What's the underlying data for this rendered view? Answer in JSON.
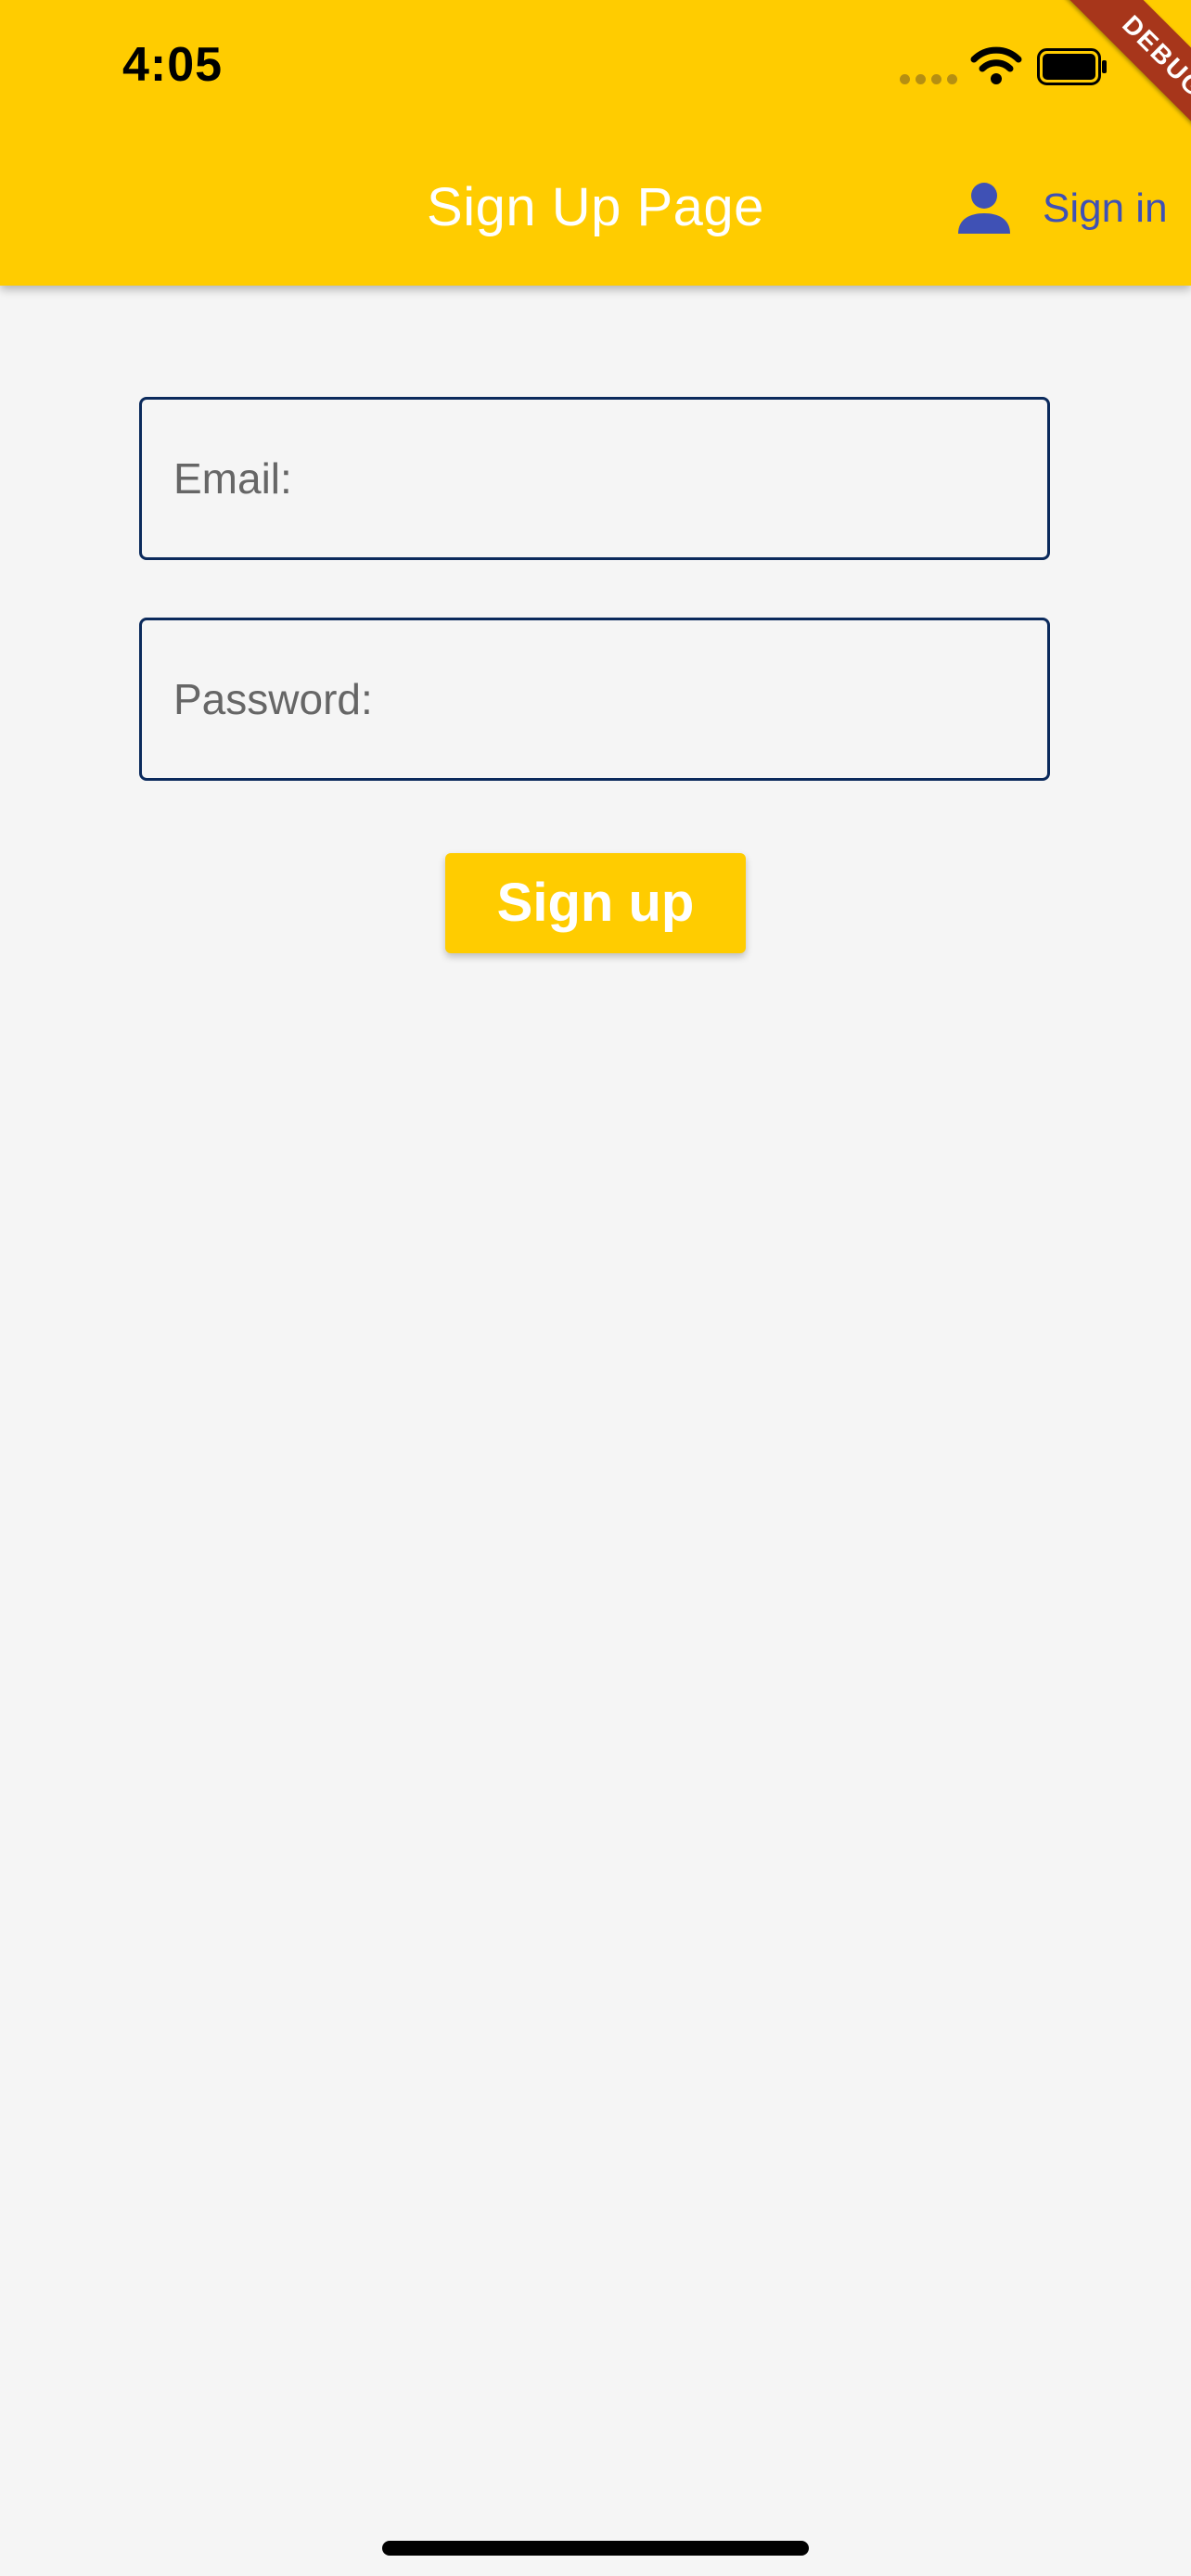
{
  "status_bar": {
    "time": "4:05"
  },
  "app_bar": {
    "title": "Sign Up Page",
    "background_color": "#ffcc00",
    "title_color": "#ffffff",
    "action": {
      "label": "Sign in",
      "icon": "person-icon",
      "color": "#3f51b5"
    },
    "debug_banner": "DEBUG"
  },
  "form": {
    "email": {
      "placeholder": "Email:",
      "value": ""
    },
    "password": {
      "placeholder": "Password:",
      "value": ""
    },
    "submit_label": "Sign up",
    "field_border_color": "#0b2a5c"
  },
  "page": {
    "background_color": "#f5f5f5"
  }
}
